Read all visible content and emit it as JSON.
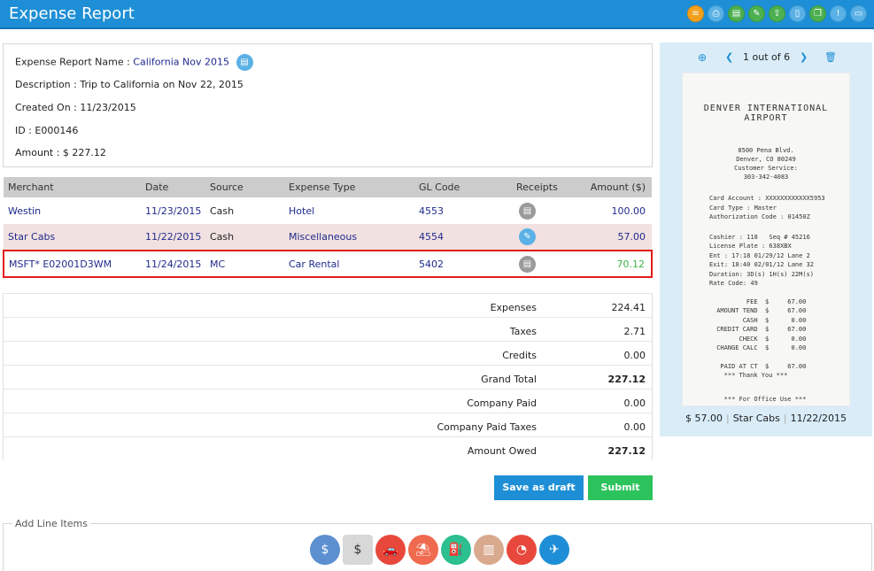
{
  "header": {
    "title": "Expense Report"
  },
  "toolbar": {
    "icons": [
      "list-icon",
      "print-icon",
      "table-icon",
      "edit-icon",
      "export-icon",
      "document-icon",
      "copy-icon",
      "code-icon",
      "comment-icon"
    ]
  },
  "report": {
    "name_label": "Expense Report Name :",
    "name_value": "California Nov 2015",
    "description": "Description : Trip to California on Nov 22, 2015",
    "created": "Created On : 11/23/2015",
    "id": "ID : E000146",
    "amount": "Amount : $ 227.12"
  },
  "table": {
    "headers": [
      "Merchant",
      "Date",
      "Source",
      "Expense Type",
      "GL Code",
      "Receipts",
      "Amount ($)"
    ],
    "rows": [
      {
        "merchant": "Westin",
        "date": "11/23/2015",
        "source": "Cash",
        "type": "Hotel",
        "gl": "4553",
        "amount": "100.00"
      },
      {
        "merchant": "Star Cabs",
        "date": "11/22/2015",
        "source": "Cash",
        "type": "Miscellaneous",
        "gl": "4554",
        "amount": "57.00"
      },
      {
        "merchant": "MSFT* E02001D3WM",
        "date": "11/24/2015",
        "source": "MC",
        "type": "Car Rental",
        "gl": "5402",
        "amount": "70.12"
      }
    ]
  },
  "totals": {
    "expenses_label": "Expenses",
    "expenses": "224.41",
    "taxes_label": "Taxes",
    "taxes": "2.71",
    "credits_label": "Credits",
    "credits": "0.00",
    "grand_label": "Grand Total",
    "grand": "227.12",
    "company_paid_label": "Company Paid",
    "company_paid": "0.00",
    "company_taxes_label": "Company Paid Taxes",
    "company_taxes": "0.00",
    "owed_label": "Amount Owed",
    "owed": "227.12"
  },
  "buttons": {
    "draft": "Save as draft",
    "submit": "Submit"
  },
  "receipt_viewer": {
    "pager": "1 out of 6",
    "footer_amount": "$ 57.00",
    "footer_merchant": "Star Cabs",
    "footer_date": "11/22/2015",
    "receipt_title_1": "DENVER INTERNATIONAL",
    "receipt_title_2": "AIRPORT",
    "receipt_address": "8500 Pena Blvd.\nDenver, CO 80249\nCustomer Service:\n303-342-4083",
    "receipt_card": "Card Account : XXXXXXXXXXXX5953\nCard Type : Master\nAuthorization Code : 01450Z",
    "receipt_ticket": "Cashier : 118   Seq # 45216\nLicense Plate : 638XBX\nEnt : 17:18 01/29/12 Lane 2\nExit: 18:40 02/01/12 Lane 32\nDuration: 3D(s) 1H(s) 22M(s)\nRate Code: 49",
    "receipt_fees": "         FEE  $     67.00\n AMOUNT TEND  $     67.00\n        CASH  $      0.00\n CREDIT CARD  $     67.00\n       CHECK  $      0.00\n CHANGE CALC  $      0.00",
    "receipt_paid": "  PAID AT CT  $     67.00\n   *** Thank You ***",
    "receipt_office": "   *** For Office Use ***"
  },
  "add_line_items": {
    "legend": "Add Line Items",
    "categories": [
      "money-bag-icon",
      "receipt-calculator-icon",
      "car-icon",
      "beach-icon",
      "fuel-icon",
      "hotel-icon",
      "gauge-icon",
      "airplane-icon"
    ]
  },
  "colors": {
    "brand": "#1e8fd6",
    "submit": "#2dc35c",
    "highlight": "#e21b1b",
    "panel": "#d9ecf8"
  }
}
